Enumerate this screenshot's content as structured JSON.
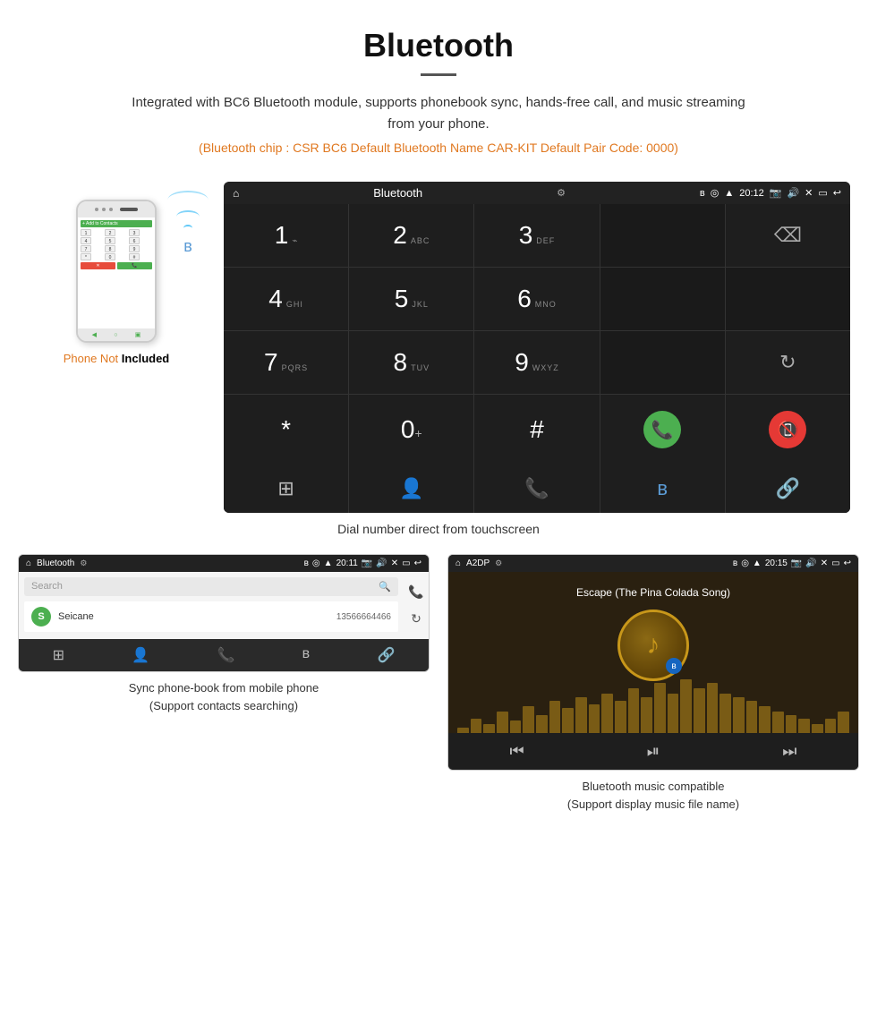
{
  "page": {
    "title": "Bluetooth",
    "description": "Integrated with BC6 Bluetooth module, supports phonebook sync, hands-free call, and music streaming from your phone.",
    "specs": "(Bluetooth chip : CSR BC6    Default Bluetooth Name CAR-KIT    Default Pair Code: 0000)",
    "dial_caption": "Dial number direct from touchscreen",
    "phone_label_orange": "Phone Not",
    "phone_label_bold": "Included",
    "bottom_left_caption": "Sync phone-book from mobile phone\n(Support contacts searching)",
    "bottom_right_caption": "Bluetooth music compatible\n(Support display music file name)"
  },
  "dial_screen": {
    "title": "Bluetooth",
    "status_time": "20:12",
    "keys": [
      {
        "main": "1",
        "sub": ""
      },
      {
        "main": "2",
        "sub": "ABC"
      },
      {
        "main": "3",
        "sub": "DEF"
      },
      {
        "main": "",
        "sub": ""
      },
      {
        "main": "⌫",
        "sub": ""
      }
    ],
    "song_title": "Escape (The Pina Colada Song)"
  },
  "phonebook": {
    "title": "Bluetooth",
    "status_time": "20:11",
    "search_placeholder": "Search",
    "contact": {
      "initial": "S",
      "name": "Seicane",
      "number": "13566664466"
    }
  },
  "music": {
    "title": "A2DP",
    "status_time": "20:15",
    "song_title": "Escape (The Pina Colada Song)",
    "viz_bars": [
      3,
      8,
      5,
      12,
      7,
      15,
      10,
      18,
      14,
      20,
      16,
      22,
      18,
      25,
      20,
      28,
      22,
      30,
      25,
      28,
      22,
      20,
      18,
      15,
      12,
      10,
      8,
      5,
      8,
      12
    ]
  },
  "icons": {
    "home": "⌂",
    "bluetooth": "⚡",
    "usb": "⚙",
    "wifi": "📶",
    "location": "📍",
    "signal": "▲",
    "camera": "📷",
    "volume": "🔊",
    "back": "↩",
    "keypad": "⊞",
    "person": "👤",
    "phone_call": "📞",
    "bt_symbol": "ʙ",
    "link": "🔗",
    "search": "🔍",
    "refresh": "↻",
    "call_green": "📞",
    "end_call": "📵",
    "prev": "⏮",
    "play_pause": "⏯",
    "next": "⏭"
  }
}
